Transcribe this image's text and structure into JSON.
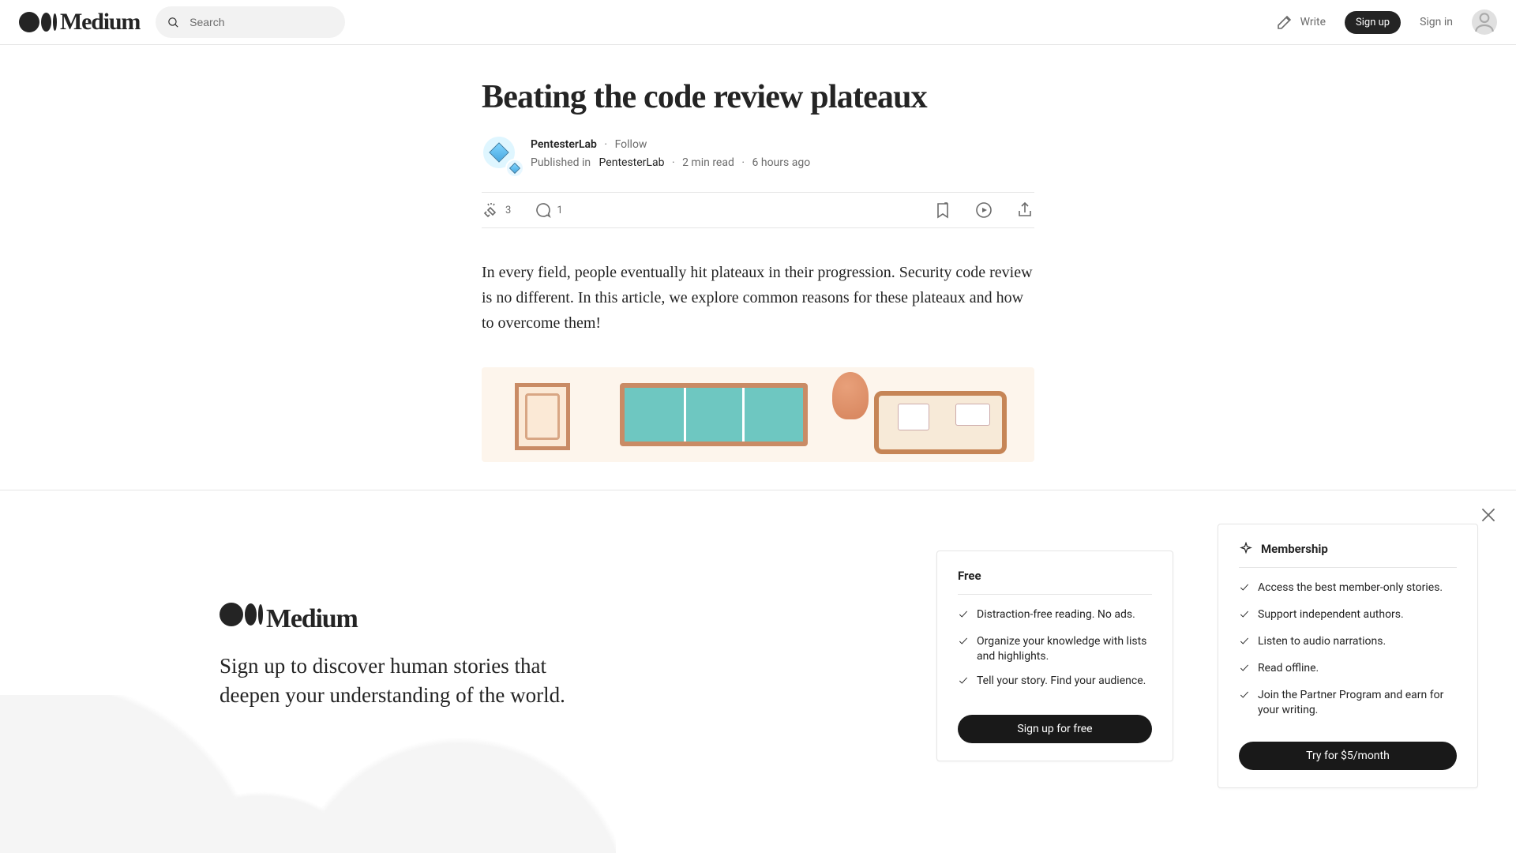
{
  "header": {
    "search_placeholder": "Search",
    "write_label": "Write",
    "signup_label": "Sign up",
    "signin_label": "Sign in"
  },
  "article": {
    "title": "Beating the code review plateaux",
    "author": "PentesterLab",
    "follow_label": "Follow",
    "published_in_prefix": "Published in",
    "publication": "PentesterLab",
    "read_time": "2 min read",
    "posted_ago": "6 hours ago",
    "clap_count": "3",
    "comment_count": "1",
    "paragraph_1": "In every field, people eventually hit plateaux in their progression. Security code review is no different. In this article, we explore common reasons for these plateaux and how to overcome them!"
  },
  "sheet": {
    "tagline": "Sign up to discover human stories that deepen your understanding of the world.",
    "free": {
      "title": "Free",
      "items": [
        "Distraction-free reading. No ads.",
        "Organize your knowledge with lists and highlights.",
        "Tell your story. Find your audience."
      ],
      "cta": "Sign up for free"
    },
    "membership": {
      "title": "Membership",
      "items": [
        "Access the best member-only stories.",
        "Support independent authors.",
        "Listen to audio narrations.",
        "Read offline.",
        "Join the Partner Program and earn for your writing."
      ],
      "cta": "Try for $5/month"
    }
  }
}
